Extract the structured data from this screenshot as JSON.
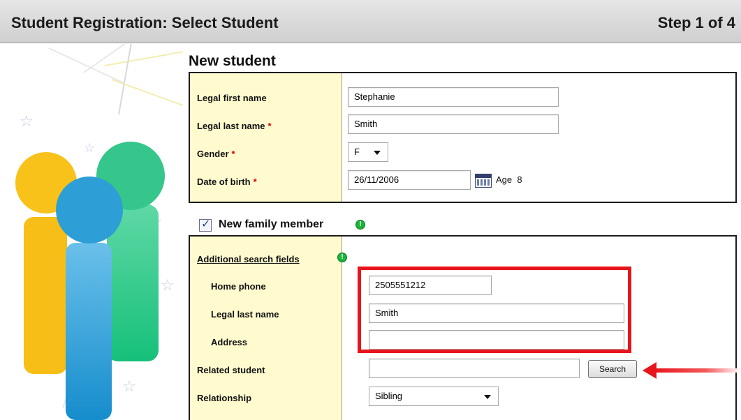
{
  "header": {
    "title": "Student Registration: Select Student",
    "step": "Step 1 of 4"
  },
  "new_student": {
    "title": "New student",
    "fields": {
      "first_name": {
        "label": "Legal first name",
        "value": "Stephanie"
      },
      "last_name": {
        "label": "Legal last name",
        "value": "Smith",
        "required": "*"
      },
      "gender": {
        "label": "Gender",
        "value": "F",
        "required": "*"
      },
      "dob": {
        "label": "Date of birth",
        "value": "26/11/2006",
        "required": "*",
        "age_label": "Age",
        "age_value": "8"
      }
    }
  },
  "family": {
    "checkbox_label": "New family member",
    "checked": true,
    "additional_search_label": "Additional search fields",
    "home_phone": {
      "label": "Home phone",
      "value": "2505551212"
    },
    "last_name": {
      "label": "Legal last name",
      "value": "Smith"
    },
    "address": {
      "label": "Address",
      "value": ""
    },
    "related_student": {
      "label": "Related student",
      "value": ""
    },
    "relationship": {
      "label": "Relationship",
      "value": "Sibling"
    },
    "search_button": "Search"
  },
  "colors": {
    "label_bg": "#fffbcf",
    "required": "#d40000",
    "highlight": "#e8141c",
    "info": "#1bb43a"
  },
  "icons": {
    "calendar": "calendar-icon",
    "info": "info-icon",
    "check": "checkmark-icon"
  }
}
